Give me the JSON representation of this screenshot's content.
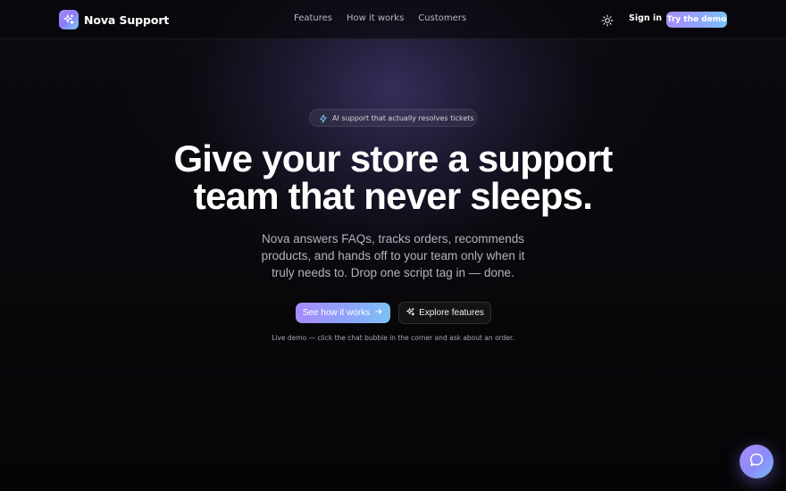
{
  "brand": {
    "name": "Nova Support",
    "logo_icon": "sparkles-icon"
  },
  "nav": {
    "links": [
      "Features",
      "How it works",
      "Customers"
    ],
    "theme_toggle_icon": "sun-icon",
    "signin_label": "Sign in",
    "cta_label": "Try the demo"
  },
  "hero": {
    "badge_icon": "lightning-icon",
    "badge_text": "AI support that actually resolves tickets",
    "headline_line1": "Give your store a support",
    "headline_line2": "team that never sleeps.",
    "subhead": "Nova answers FAQs, tracks orders, recommends products, and hands off to your team only when it truly needs to. Drop one script tag in — done.",
    "primary_cta": "See how it works",
    "primary_cta_icon": "arrow-right-icon",
    "secondary_cta": "Explore features",
    "secondary_cta_icon": "sparkles-icon",
    "note": "Live demo — click the chat bubble in the corner and ask about an order."
  },
  "chat_widget": {
    "icon": "chat-bubble-icon"
  },
  "colors": {
    "accent_start": "#a78bfa",
    "accent_end": "#7cc4f5",
    "background": "#050507"
  }
}
